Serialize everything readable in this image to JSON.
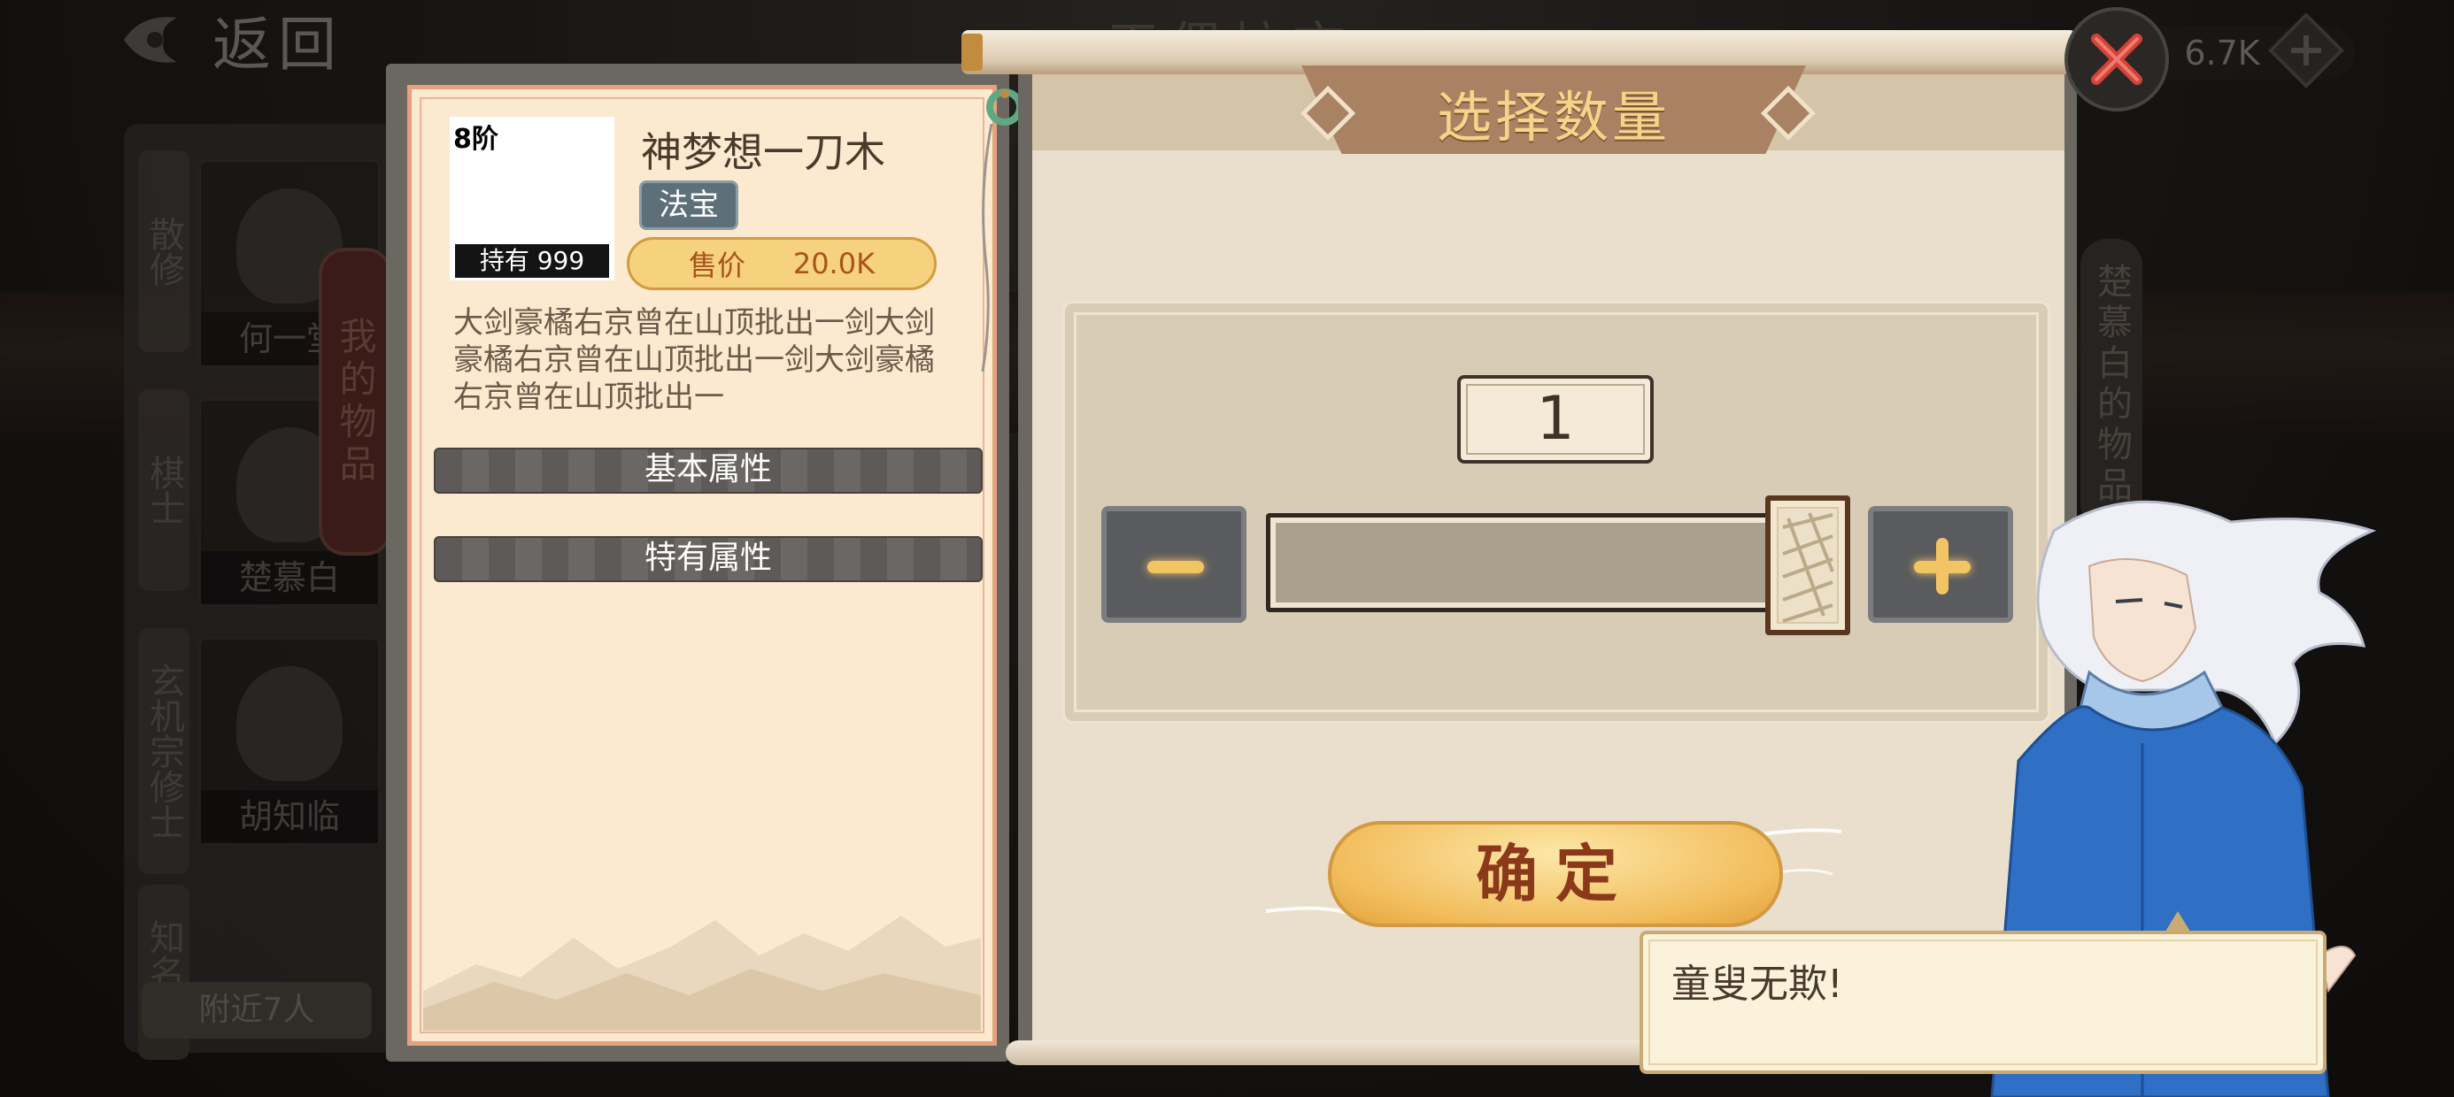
{
  "background": {
    "back_label": "返回",
    "title": "天偶坊市",
    "currency_value": "6.7K",
    "left_categories": [
      "散修",
      "棋士",
      "玄机宗修士",
      "知名散"
    ],
    "left_cards": [
      "何一堂",
      "楚慕白",
      "胡知临"
    ],
    "nearby": "附近7人",
    "my_items_tag": "我的物品",
    "right_tag": "楚慕白的物品"
  },
  "item": {
    "tier": "8阶",
    "owned": "持有 999",
    "name": "神梦想一刀木",
    "type": "法宝",
    "price_label": "售价",
    "price_value": "20.0K",
    "description": "大剑豪橘右京曾在山顶批出一剑大剑豪橘右京曾在山顶批出一剑大剑豪橘右京曾在山顶批出一",
    "sections": [
      "基本属性",
      "特有属性"
    ]
  },
  "quantity_dialog": {
    "title": "选择数量",
    "value": "1",
    "slider_fraction": 1.0,
    "confirm_label": "确定"
  },
  "speech": {
    "text": "童叟无欺!"
  },
  "colors": {
    "panel_bg": "#fbead0",
    "accent_gold": "#f3c464",
    "title_gold": "#f5d489",
    "price_text": "#a9521e"
  }
}
